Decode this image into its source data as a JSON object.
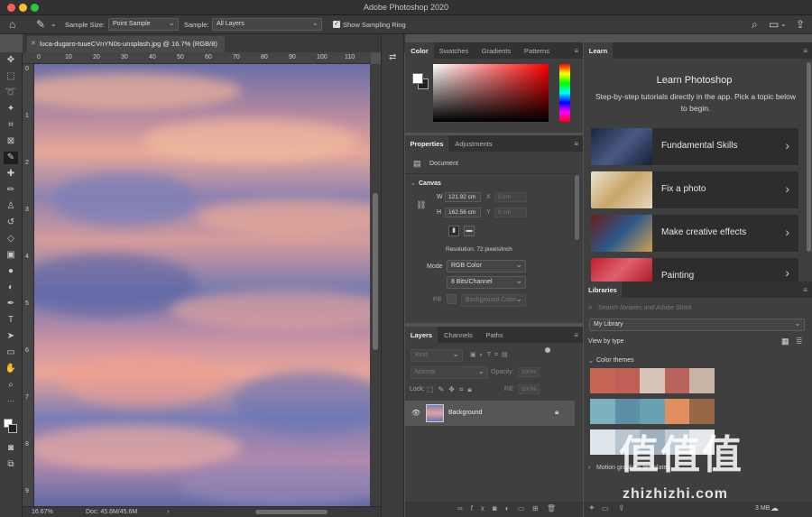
{
  "app": {
    "title": "Adobe Photoshop 2020"
  },
  "options_bar": {
    "sample_size_label": "Sample Size:",
    "sample_size_value": "Point Sample",
    "sample_label": "Sample:",
    "sample_value": "All Layers",
    "show_sampling_ring_label": "Show Sampling Ring",
    "show_sampling_ring_checked": true
  },
  "document": {
    "tab_title": "luca-dugaro-tuueCVnYN0s-unsplash.jpg @ 16.7% (RGB/8)",
    "ruler_h": [
      "0",
      "10",
      "20",
      "30",
      "40",
      "50",
      "60",
      "70",
      "80",
      "90",
      "100",
      "110"
    ],
    "ruler_v": [
      "0",
      "1",
      "2",
      "3",
      "4",
      "5",
      "6",
      "7",
      "8",
      "9"
    ],
    "zoom": "16.67%",
    "doc_size": "Doc: 45.6M/45.6M"
  },
  "color_panel": {
    "tabs": [
      "Color",
      "Swatches",
      "Gradients",
      "Patterns"
    ],
    "active_tab": 0,
    "foreground": "#ffffff",
    "background": "#222222"
  },
  "properties_panel": {
    "tabs": [
      "Properties",
      "Adjustments"
    ],
    "active_tab": 0,
    "section_type": "Document",
    "canvas_heading": "Canvas",
    "w_label": "W",
    "w_value": "121.92 cm",
    "h_label": "H",
    "h_value": "162.56 cm",
    "x_label": "X",
    "x_value": "0 cm",
    "y_label": "Y",
    "y_value": "0 cm",
    "resolution": "Resolution: 72 pixels/inch",
    "mode_label": "Mode",
    "mode_value": "RGB Color",
    "bits_value": "8 Bits/Channel",
    "fill_label": "Fill",
    "fill_value": "Background Color"
  },
  "layers_panel": {
    "tabs": [
      "Layers",
      "Channels",
      "Paths"
    ],
    "active_tab": 0,
    "kind_placeholder": "Kind",
    "blend_mode": "Normal",
    "opacity_label": "Opacity:",
    "opacity_value": "100%",
    "lock_label": "Lock:",
    "fill_label": "Fill:",
    "fill_value": "100%",
    "layers": [
      {
        "name": "Background",
        "visible": true,
        "locked": true
      }
    ]
  },
  "learn_panel": {
    "tab": "Learn",
    "heading": "Learn Photoshop",
    "description": "Step-by-step tutorials directly in the app. Pick a topic below to begin.",
    "topics": [
      "Fundamental Skills",
      "Fix a photo",
      "Make creative effects",
      "Painting"
    ]
  },
  "libraries_panel": {
    "tab": "Libraries",
    "search_placeholder": "Search libraries and Adobe Stock",
    "library_value": "My Library",
    "view_by": "View by type",
    "color_themes_label": "Color themes",
    "color_themes": [
      [
        "#c46556",
        "#bf5f55",
        "#d8c4b8",
        "#b8645c",
        "#c9b4a6"
      ],
      [
        "#7cb2c0",
        "#5d8fa8",
        "#6aa1b2",
        "#e08f5e",
        "#9a6648"
      ],
      [
        "#dde4ea",
        "#b8c6d2",
        "#9fb0c0",
        "#c3cdd6",
        "#e6e9ec"
      ]
    ],
    "motion_label": "Motion graphics templates",
    "storage": "3 MB"
  },
  "watermark": {
    "icon_text": "值",
    "site": "zhizhizhi.com"
  }
}
